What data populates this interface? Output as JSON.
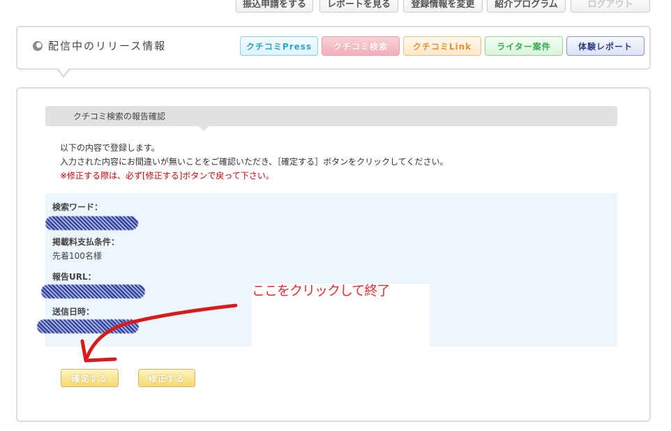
{
  "top_nav": {
    "items": [
      {
        "label": "振込申請をする",
        "enabled": true
      },
      {
        "label": "レポートを見る",
        "enabled": true
      },
      {
        "label": "登録情報を変更",
        "enabled": true
      },
      {
        "label": "紹介プログラム",
        "enabled": true
      },
      {
        "label": "ログアウト",
        "enabled": false
      }
    ]
  },
  "release_panel": {
    "title": "配信中のリリース情報",
    "icon": "circle-arrow-icon",
    "service_buttons": [
      {
        "label": "クチコミPress",
        "color": "#2aa4cc"
      },
      {
        "label": "クチコミ検索",
        "color": "#f1aebb"
      },
      {
        "label": "クチコミLink",
        "color": "#e8912c"
      },
      {
        "label": "ライター案件",
        "color": "#35a847"
      },
      {
        "label": "体験レポート",
        "color": "#2d3d86"
      }
    ]
  },
  "main": {
    "section_title": "クチコミ検索の報告確認",
    "instructions": {
      "line1": "以下の内容で登録します。",
      "line2": "入力された内容にお間違いが無いことをご確認いただき、［確定する］ボタンをクリックしてください。",
      "warning": "※修正する際は、必ず[修正する]ボタンで戻って下さい。"
    },
    "fields": [
      {
        "label": "検索ワード：",
        "value": ""
      },
      {
        "label": "掲載料支払条件：",
        "value": "先着100名様"
      },
      {
        "label": "報告URL：",
        "value": ""
      },
      {
        "label": "送信日時：",
        "value": ""
      }
    ],
    "annotation_text": "ここをクリックして終了",
    "buttons": {
      "confirm": "確定する",
      "edit": "修正する"
    }
  }
}
